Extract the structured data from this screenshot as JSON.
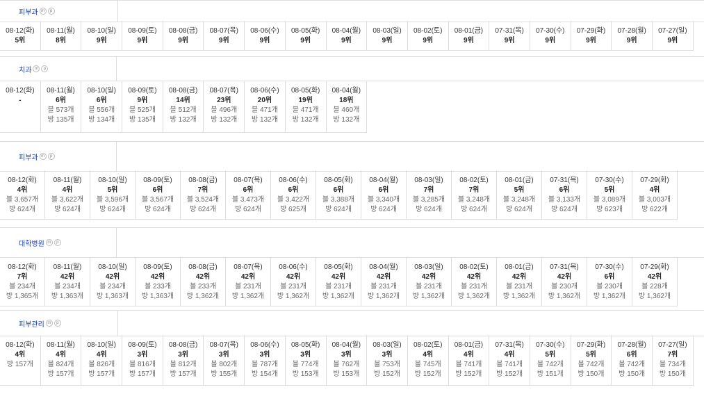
{
  "sections": [
    {
      "keyword": "피부과",
      "days": [
        {
          "date": "08-12(화)",
          "rank": "5위"
        },
        {
          "date": "08-11(월)",
          "rank": "8위"
        },
        {
          "date": "08-10(일)",
          "rank": "9위"
        },
        {
          "date": "08-09(토)",
          "rank": "9위"
        },
        {
          "date": "08-08(금)",
          "rank": "9위"
        },
        {
          "date": "08-07(목)",
          "rank": "9위"
        },
        {
          "date": "08-06(수)",
          "rank": "9위"
        },
        {
          "date": "08-05(화)",
          "rank": "9위"
        },
        {
          "date": "08-04(월)",
          "rank": "9위"
        },
        {
          "date": "08-03(일)",
          "rank": "9위"
        },
        {
          "date": "08-02(토)",
          "rank": "9위"
        },
        {
          "date": "08-01(금)",
          "rank": "9위"
        },
        {
          "date": "07-31(목)",
          "rank": "9위"
        },
        {
          "date": "07-30(수)",
          "rank": "9위"
        },
        {
          "date": "07-29(화)",
          "rank": "9위"
        },
        {
          "date": "07-28(월)",
          "rank": "9위"
        },
        {
          "date": "07-27(일)",
          "rank": "9위"
        }
      ]
    },
    {
      "keyword": "치과",
      "days": [
        {
          "date": "08-12(화)",
          "rank": "-"
        },
        {
          "date": "08-11(월)",
          "rank": "6위",
          "blog": "블 573개",
          "bang": "방 135개"
        },
        {
          "date": "08-10(일)",
          "rank": "6위",
          "blog": "블 556개",
          "bang": "방 134개"
        },
        {
          "date": "08-09(토)",
          "rank": "9위",
          "blog": "블 525개",
          "bang": "방 135개"
        },
        {
          "date": "08-08(금)",
          "rank": "14위",
          "blog": "블 512개",
          "bang": "방 132개"
        },
        {
          "date": "08-07(목)",
          "rank": "23위",
          "blog": "블 496개",
          "bang": "방 132개"
        },
        {
          "date": "08-06(수)",
          "rank": "20위",
          "blog": "블 471개",
          "bang": "방 132개"
        },
        {
          "date": "08-05(화)",
          "rank": "19위",
          "blog": "블 471개",
          "bang": "방 132개"
        },
        {
          "date": "08-04(월)",
          "rank": "18위",
          "blog": "블 460개",
          "bang": "방 132개"
        }
      ]
    },
    {
      "keyword": "피부과",
      "days": [
        {
          "date": "08-12(화)",
          "rank": "4위",
          "blog": "블 3,657개",
          "bang": "방 624개"
        },
        {
          "date": "08-11(월)",
          "rank": "4위",
          "blog": "블 3,622개",
          "bang": "방 624개"
        },
        {
          "date": "08-10(일)",
          "rank": "5위",
          "blog": "블 3,596개",
          "bang": "방 624개"
        },
        {
          "date": "08-09(토)",
          "rank": "6위",
          "blog": "블 3,567개",
          "bang": "방 624개"
        },
        {
          "date": "08-08(금)",
          "rank": "7위",
          "blog": "블 3,524개",
          "bang": "방 624개"
        },
        {
          "date": "08-07(목)",
          "rank": "6위",
          "blog": "블 3,473개",
          "bang": "방 624개"
        },
        {
          "date": "08-06(수)",
          "rank": "6위",
          "blog": "블 3,422개",
          "bang": "방 625개"
        },
        {
          "date": "08-05(화)",
          "rank": "6위",
          "blog": "블 3,388개",
          "bang": "방 624개"
        },
        {
          "date": "08-04(월)",
          "rank": "6위",
          "blog": "블 3,340개",
          "bang": "방 624개"
        },
        {
          "date": "08-03(일)",
          "rank": "7위",
          "blog": "블 3,285개",
          "bang": "방 624개"
        },
        {
          "date": "08-02(토)",
          "rank": "7위",
          "blog": "블 3,248개",
          "bang": "방 624개"
        },
        {
          "date": "08-01(금)",
          "rank": "5위",
          "blog": "블 3,248개",
          "bang": "방 624개"
        },
        {
          "date": "07-31(목)",
          "rank": "6위",
          "blog": "블 3,133개",
          "bang": "방 624개"
        },
        {
          "date": "07-30(수)",
          "rank": "5위",
          "blog": "블 3,089개",
          "bang": "방 623개"
        },
        {
          "date": "07-29(화)",
          "rank": "4위",
          "blog": "블 3,003개",
          "bang": "방 622개"
        }
      ]
    },
    {
      "keyword": "대학병원",
      "days": [
        {
          "date": "08-12(화)",
          "rank": "7위",
          "blog": "블 234개",
          "bang": "방 1,365개"
        },
        {
          "date": "08-11(월)",
          "rank": "42위",
          "blog": "블 234개",
          "bang": "방 1,363개"
        },
        {
          "date": "08-10(일)",
          "rank": "42위",
          "blog": "블 234개",
          "bang": "방 1,363개"
        },
        {
          "date": "08-09(토)",
          "rank": "42위",
          "blog": "블 233개",
          "bang": "방 1,363개"
        },
        {
          "date": "08-08(금)",
          "rank": "42위",
          "blog": "블 233개",
          "bang": "방 1,362개"
        },
        {
          "date": "08-07(목)",
          "rank": "42위",
          "blog": "블 231개",
          "bang": "방 1,362개"
        },
        {
          "date": "08-06(수)",
          "rank": "42위",
          "blog": "블 231개",
          "bang": "방 1,362개"
        },
        {
          "date": "08-05(화)",
          "rank": "42위",
          "blog": "블 231개",
          "bang": "방 1,362개"
        },
        {
          "date": "08-04(월)",
          "rank": "42위",
          "blog": "블 231개",
          "bang": "방 1,362개"
        },
        {
          "date": "08-03(일)",
          "rank": "42위",
          "blog": "블 231개",
          "bang": "방 1,362개"
        },
        {
          "date": "08-02(토)",
          "rank": "42위",
          "blog": "블 231개",
          "bang": "방 1,362개"
        },
        {
          "date": "08-01(금)",
          "rank": "42위",
          "blog": "블 231개",
          "bang": "방 1,362개"
        },
        {
          "date": "07-31(목)",
          "rank": "42위",
          "blog": "블 230개",
          "bang": "방 1,362개"
        },
        {
          "date": "07-30(수)",
          "rank": "6위",
          "blog": "블 230개",
          "bang": "방 1,362개"
        },
        {
          "date": "07-29(화)",
          "rank": "42위",
          "blog": "블 228개",
          "bang": "방 1,362개"
        }
      ]
    },
    {
      "keyword": "피부관리",
      "days": [
        {
          "date": "08-12(화)",
          "rank": "4위",
          "bang": "방 157개"
        },
        {
          "date": "08-11(월)",
          "rank": "4위",
          "blog": "블 824개",
          "bang": "방 157개"
        },
        {
          "date": "08-10(일)",
          "rank": "4위",
          "blog": "블 826개",
          "bang": "방 157개"
        },
        {
          "date": "08-09(토)",
          "rank": "3위",
          "blog": "블 816개",
          "bang": "방 157개"
        },
        {
          "date": "08-08(금)",
          "rank": "3위",
          "blog": "블 812개",
          "bang": "방 157개"
        },
        {
          "date": "08-07(목)",
          "rank": "3위",
          "blog": "블 802개",
          "bang": "방 155개"
        },
        {
          "date": "08-06(수)",
          "rank": "3위",
          "blog": "블 787개",
          "bang": "방 154개"
        },
        {
          "date": "08-05(화)",
          "rank": "3위",
          "blog": "블 774개",
          "bang": "방 153개"
        },
        {
          "date": "08-04(월)",
          "rank": "3위",
          "blog": "블 762개",
          "bang": "방 153개"
        },
        {
          "date": "08-03(일)",
          "rank": "3위",
          "blog": "블 753개",
          "bang": "방 152개"
        },
        {
          "date": "08-02(토)",
          "rank": "4위",
          "blog": "블 745개",
          "bang": "방 152개"
        },
        {
          "date": "08-01(금)",
          "rank": "4위",
          "blog": "블 741개",
          "bang": "방 152개"
        },
        {
          "date": "07-31(목)",
          "rank": "4위",
          "blog": "블 741개",
          "bang": "방 152개"
        },
        {
          "date": "07-30(수)",
          "rank": "5위",
          "blog": "블 742개",
          "bang": "방 151개"
        },
        {
          "date": "07-29(화)",
          "rank": "5위",
          "blog": "블 742개",
          "bang": "방 150개"
        },
        {
          "date": "07-28(월)",
          "rank": "6위",
          "blog": "블 742개",
          "bang": "방 150개"
        },
        {
          "date": "07-27(일)",
          "rank": "7위",
          "blog": "블 734개",
          "bang": "방 150개"
        }
      ]
    }
  ]
}
